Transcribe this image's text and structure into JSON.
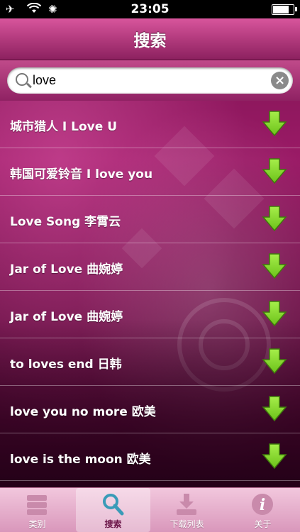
{
  "status_bar": {
    "time": "23:05",
    "battery_level": 0.85
  },
  "nav": {
    "title": "搜索"
  },
  "search": {
    "value": "love",
    "placeholder": ""
  },
  "results": [
    {
      "title": "城市猎人 I Love U"
    },
    {
      "title": "韩国可爱铃音 I love you"
    },
    {
      "title": "Love Song 李霄云"
    },
    {
      "title": "Jar of Love 曲婉婷"
    },
    {
      "title": "Jar of Love 曲婉婷"
    },
    {
      "title": "to loves end 日韩"
    },
    {
      "title": "love you no more 欧美"
    },
    {
      "title": "love is the moon 欧美"
    }
  ],
  "tabs": [
    {
      "label": "类别",
      "icon": "server-stack-icon",
      "active": false
    },
    {
      "label": "搜索",
      "icon": "magnifier-icon",
      "active": true
    },
    {
      "label": "下载列表",
      "icon": "download-tray-icon",
      "active": false
    },
    {
      "label": "关于",
      "icon": "info-icon",
      "active": false
    }
  ],
  "colors": {
    "accent": "#b23a7d",
    "download_arrow": "#6cc21a"
  }
}
